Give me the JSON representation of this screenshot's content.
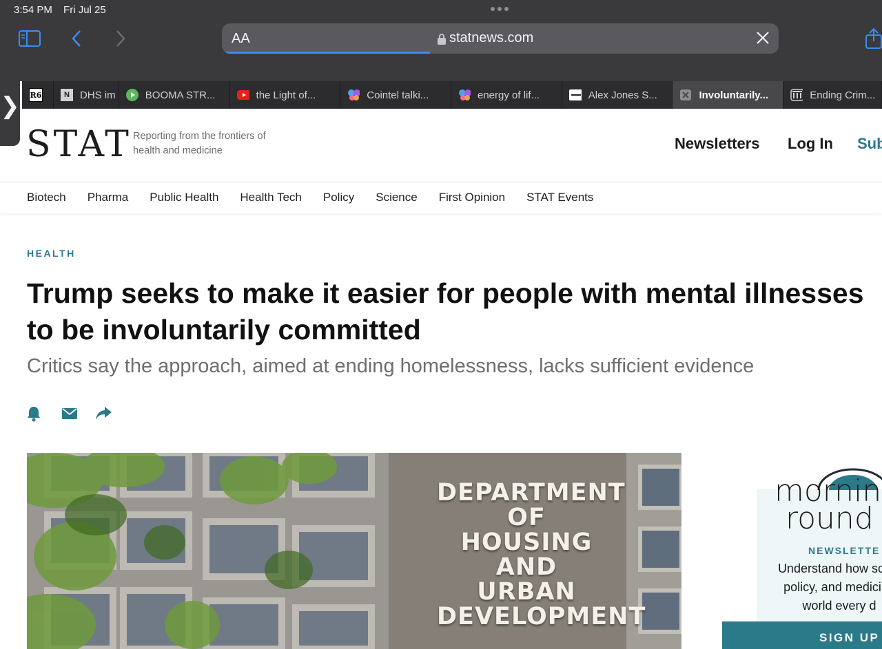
{
  "status": {
    "time": "3:54 PM",
    "date": "Fri Jul 25"
  },
  "toolbar": {
    "text_size_label": "AA",
    "url": "statnews.com",
    "load_progress": 0.374
  },
  "tabs": [
    {
      "label": "",
      "favicon_text": "R6"
    },
    {
      "label": "DHS im",
      "favicon_text": "N"
    },
    {
      "label": "BOOMA STR...",
      "favicon": "play-icon"
    },
    {
      "label": "the Light of...",
      "favicon": "youtube-icon"
    },
    {
      "label": "Cointel talki...",
      "favicon": "butterfly-icon"
    },
    {
      "label": "energy of lif...",
      "favicon": "butterfly-icon"
    },
    {
      "label": "Alex Jones S...",
      "favicon": "news-icon"
    },
    {
      "label": "Involuntarily...",
      "favicon": "close-icon",
      "active": true
    },
    {
      "label": "Ending Crim...",
      "favicon": "building-icon"
    }
  ],
  "site": {
    "logo": "STAT",
    "tagline": "Reporting from the frontiers of health and medicine",
    "header_links": {
      "newsletters": "Newsletters",
      "login": "Log In",
      "subscribe": "Sub"
    },
    "nav": [
      "Biotech",
      "Pharma",
      "Public Health",
      "Health Tech",
      "Policy",
      "Science",
      "First Opinion",
      "STAT Events"
    ]
  },
  "article": {
    "section": "HEALTH",
    "headline": "Trump seeks to make it easier for people with mental illnesses to be involuntarily committed",
    "dek": "Critics say the approach, aimed at ending homelessness, lacks sufficient evidence"
  },
  "photo": {
    "sign_lines": [
      "DEPARTMENT",
      "OF",
      "HOUSING",
      "AND",
      "URBAN",
      "DEVELOPMENT"
    ]
  },
  "ad": {
    "brand_line1": "mornin",
    "brand_line2": "round",
    "kicker": "NEWSLETTE",
    "copy1": "Understand how scien",
    "copy2": "policy, and medicine",
    "copy3": "world every d",
    "cta": "SIGN UP"
  },
  "colors": {
    "accent": "#2b7a8a",
    "chrome": "#3a3a3c",
    "link_blue": "#3d8cf5"
  }
}
